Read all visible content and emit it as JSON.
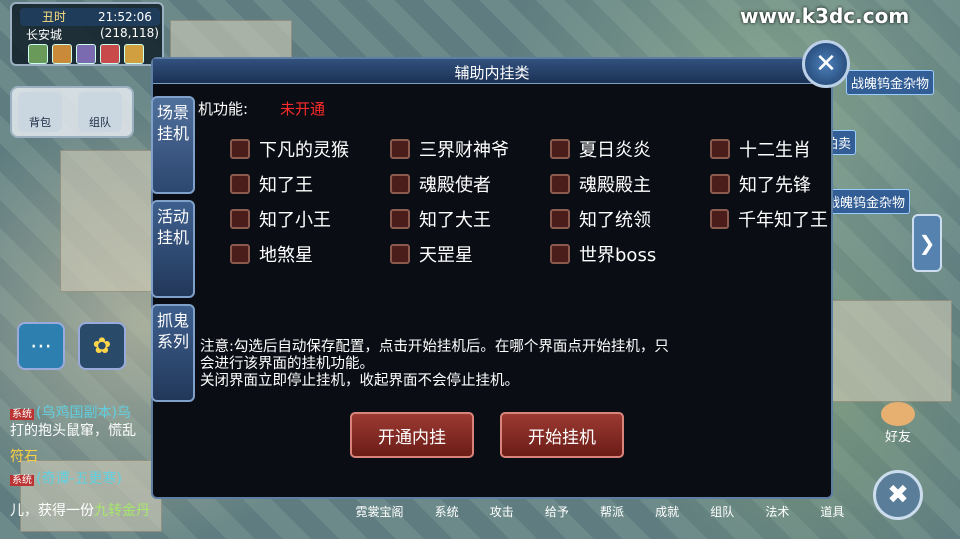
{
  "hud": {
    "shichen": "丑时",
    "clock": "21:52:06",
    "location": "长安城",
    "coords": "(218,118)"
  },
  "left_menu": {
    "btn1": "背包",
    "btn2": "组队"
  },
  "chat": {
    "line1_tag": "系统",
    "line1": "(乌鸡国副本)乌",
    "line2": "打的抱头鼠窜，慌乱",
    "line3": "符石",
    "line4_tag": "系统",
    "line4": "(奇谭-五更寒)",
    "line5_a": "儿，获得一份",
    "line5_b": "九转金丹"
  },
  "right": {
    "watermark": "www.k3dc.com",
    "label1": "战魄钨金杂物",
    "label2": "拍卖",
    "label3": "战魄钨金杂物",
    "friend": "好友"
  },
  "bottom_bar": [
    "霓裳宝阁",
    "系统",
    "攻击",
    "给予",
    "帮派",
    "成就",
    "组队",
    "法术",
    "道具"
  ],
  "dialog": {
    "title": "辅助内挂类",
    "func_label": "机功能:",
    "func_status": "未开通",
    "tabs": [
      "场景挂机",
      "活动挂机",
      "抓鬼系列"
    ],
    "options": [
      [
        "下凡的灵猴",
        "三界财神爷",
        "夏日炎炎",
        "十二生肖"
      ],
      [
        "知了王",
        "魂殿使者",
        "魂殿殿主",
        "知了先锋"
      ],
      [
        "知了小王",
        "知了大王",
        "知了统领",
        "千年知了王"
      ],
      [
        "地煞星",
        "天罡星",
        "世界boss"
      ]
    ],
    "notice_line1": "注意:勾选后自动保存配置，点击开始挂机后。在哪个界面点开始挂机，只",
    "notice_line2": "会进行该界面的挂机功能。",
    "notice_line3": "关闭界面立即停止挂机，收起界面不会停止挂机。",
    "btn_open": "开通内挂",
    "btn_start": "开始挂机"
  }
}
